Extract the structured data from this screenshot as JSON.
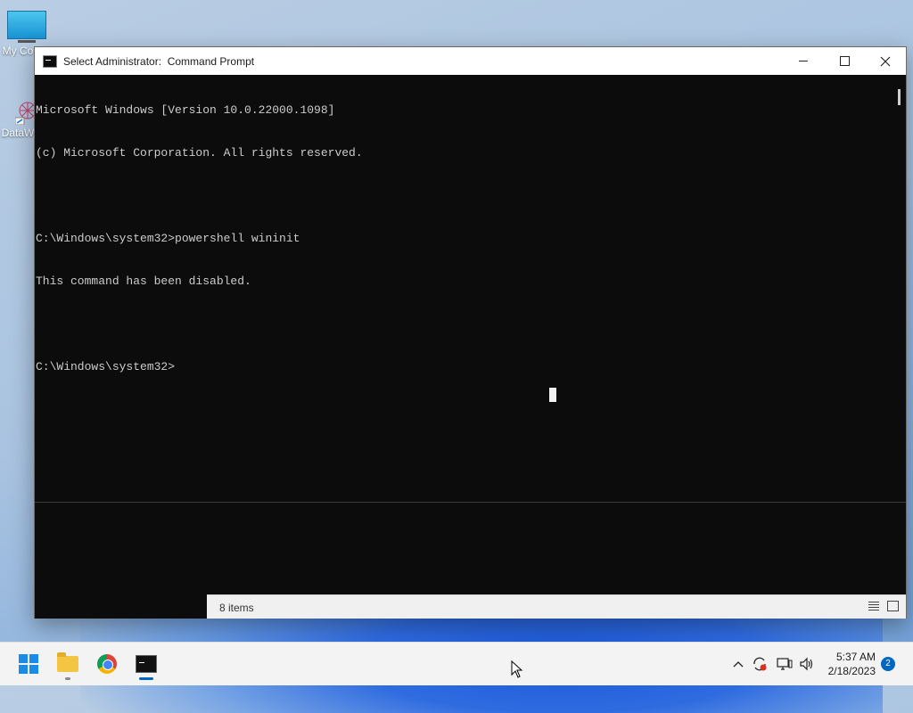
{
  "desktop": {
    "icons": [
      {
        "label": "My Co",
        "icon": "monitor-icon"
      },
      {
        "label": "DataW",
        "icon": "datawrapper-shortcut-icon"
      }
    ]
  },
  "window": {
    "title": "Select Administrator:  Command Prompt",
    "icon": "cmd-icon",
    "buttons": {
      "minimize": "minimize-icon",
      "maximize": "maximize-icon",
      "close": "close-icon"
    }
  },
  "console": {
    "lines": [
      "Microsoft Windows [Version 10.0.22000.1098]",
      "(c) Microsoft Corporation. All rights reserved.",
      "",
      "C:\\Windows\\system32>powershell wininit",
      "This command has been disabled.",
      "",
      "C:\\Windows\\system32>"
    ],
    "text_color": "#cccccc",
    "background": "#0c0c0c"
  },
  "explorer_status": {
    "items_text": "8 items",
    "view_icons": [
      "details-view-icon",
      "tiles-view-icon"
    ]
  },
  "taskbar": {
    "apps": [
      {
        "name": "start",
        "icon": "windows-start-icon"
      },
      {
        "name": "file-explorer",
        "icon": "folder-icon"
      },
      {
        "name": "chrome",
        "icon": "chrome-icon"
      },
      {
        "name": "command-prompt",
        "icon": "cmd-icon",
        "active": true
      }
    ],
    "tray": {
      "chevron": "^",
      "icons": [
        "sync-icon",
        "network-icon",
        "volume-icon"
      ],
      "time": "5:37 AM",
      "date": "2/18/2023",
      "notification_count": "2"
    },
    "accent": "#0067c0"
  }
}
